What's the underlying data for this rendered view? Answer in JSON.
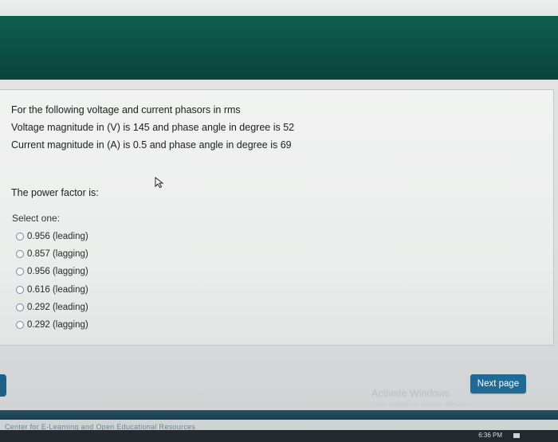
{
  "question": {
    "lines": [
      "For the following voltage and current phasors in rms",
      "Voltage magnitude in (V) is 145 and phase angle in degree is 52",
      "Current magnitude in (A) is 0.5 and phase angle in degree is 69"
    ],
    "prompt": "The power factor is:",
    "select_label": "Select one:",
    "options": [
      "0.956  (leading)",
      "0.857  (lagging)",
      "0.956  (lagging)",
      "0.616   (leading)",
      "0.292  (leading)",
      "0.292  (lagging)"
    ]
  },
  "footer": {
    "next_label": "Next page",
    "watermark_title": "Activate Windows",
    "watermark_sub": "Go to Settings to activate Windows.",
    "bottom_link": "Center for E-Learning and Open Educational Resources"
  },
  "taskbar": {
    "clock": "6:36 PM"
  },
  "colors": {
    "header": "#0c4e43",
    "next_button": "#1f6b96"
  }
}
